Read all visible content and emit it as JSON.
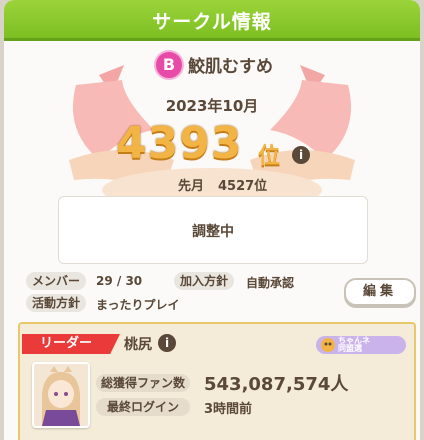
{
  "window": {
    "title": "サークル情報"
  },
  "circle": {
    "rank_badge": "B",
    "name": "鮫肌むすめ",
    "ranking_month": "2023年10月",
    "rank": "4393",
    "rank_suffix": "位",
    "prev_label": "先月",
    "prev_rank": "4527位",
    "description": "調整中"
  },
  "details": {
    "members_label": "メンバー",
    "members_value": "29 / 30",
    "join_label": "加入方針",
    "join_value": "自動承認",
    "activity_label": "活動方針",
    "activity_value": "まったりプレイ",
    "edit_label": "編集"
  },
  "leader": {
    "tag_label": "リーダー",
    "name": "桃尻",
    "team_chip_line1": "ちゃんネ",
    "team_chip_line2": "同盟選",
    "fans_label": "総獲得ファン数",
    "fans_value": "543,087,574人",
    "last_login_label": "最終ログイン",
    "last_login_value": "3時間前"
  },
  "icons": {
    "info": "i"
  },
  "colors": {
    "title_green": "#8ccb2c",
    "rank_gold": "#f2b545",
    "leader_red": "#ea3a3a",
    "rank_badge_pink": "#e84aa8"
  }
}
